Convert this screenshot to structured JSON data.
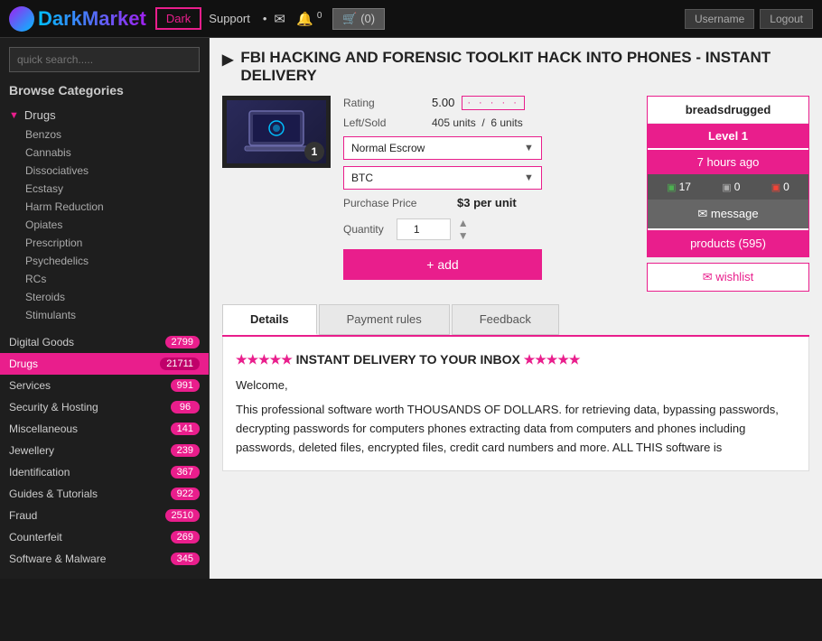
{
  "topnav": {
    "logo": "DarkMarket",
    "dark_btn": "Dark",
    "support_link": "Support",
    "cart_btn": "(0)",
    "user_btn1": "Username",
    "user_btn2": "Logout"
  },
  "sidebar": {
    "search_placeholder": "quick search.....",
    "browse_title": "Browse Categories",
    "drugs_cat": "Drugs",
    "sub_cats": [
      "Benzos",
      "Cannabis",
      "Dissociatives",
      "Ecstasy",
      "Harm Reduction",
      "Opiates",
      "Prescription",
      "Psychedelics",
      "RCs",
      "Steroids",
      "Stimulants"
    ],
    "list_items": [
      {
        "label": "Digital Goods",
        "count": "2799"
      },
      {
        "label": "Drugs",
        "count": "21711",
        "active": true
      },
      {
        "label": "Services",
        "count": "991"
      },
      {
        "label": "Security & Hosting",
        "count": "96"
      },
      {
        "label": "Miscellaneous",
        "count": "141"
      },
      {
        "label": "Jewellery",
        "count": "239"
      },
      {
        "label": "Identification",
        "count": "367"
      },
      {
        "label": "Guides & Tutorials",
        "count": "922"
      },
      {
        "label": "Fraud",
        "count": "2510"
      },
      {
        "label": "Counterfeit",
        "count": "269"
      },
      {
        "label": "Software & Malware",
        "count": "345"
      }
    ]
  },
  "product": {
    "title": "FBI HACKING AND FORENSIC TOOLKIT HACK INTO PHONES - INSTANT DELIVERY",
    "rating_label": "Rating",
    "rating_value": "5.00",
    "rating_stars": "· · · · ·",
    "leftsold_label": "Left/Sold",
    "units_left": "405 units",
    "units_sold": "6 units",
    "escrow_option": "Normal Escrow",
    "currency_option": "BTC",
    "purchase_price_label": "Purchase Price",
    "price": "$3 per unit",
    "qty_label": "Quantity",
    "qty_value": "1",
    "add_btn": "+ add"
  },
  "seller": {
    "name": "breadsdrugged",
    "level": "Level 1",
    "time": "7 hours ago",
    "stat_pos": "17",
    "stat_neutral": "0",
    "stat_neg": "0",
    "message_btn": "✉ message",
    "products_btn": "products (595)",
    "wishlist_btn": "✉ wishlist"
  },
  "tabs": [
    {
      "label": "Details",
      "active": true
    },
    {
      "label": "Payment rules",
      "active": false
    },
    {
      "label": "Feedback",
      "active": false
    }
  ],
  "description": {
    "stars": "★★★★★",
    "delivery_text": "INSTANT DELIVERY TO YOUR INBOX",
    "stars2": "★★★★★",
    "welcome": "Welcome,",
    "body": "This professional software worth THOUSANDS OF DOLLARS. for retrieving data, bypassing passwords, decrypting passwords for computers phones extracting data from computers and phones including passwords, deleted files, encrypted files, credit card numbers and more. ALL THIS software is"
  }
}
